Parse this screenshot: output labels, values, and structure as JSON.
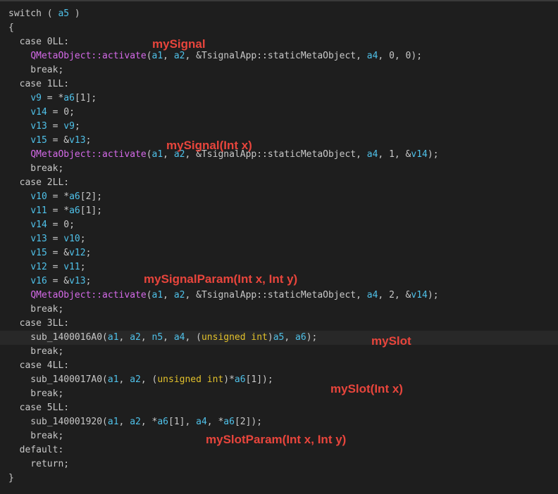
{
  "code": {
    "highlighted_line": 23,
    "lines": [
      [
        [
          "p",
          "switch ( "
        ],
        [
          "v",
          "a5"
        ],
        [
          "p",
          " )"
        ]
      ],
      [
        [
          "p",
          "{"
        ]
      ],
      [
        [
          "p",
          "  case 0LL:"
        ]
      ],
      [
        [
          "p",
          "    "
        ],
        [
          "f",
          "QMetaObject::activate"
        ],
        [
          "p",
          "("
        ],
        [
          "v",
          "a1"
        ],
        [
          "p",
          ", "
        ],
        [
          "v",
          "a2"
        ],
        [
          "p",
          ", &TsignalApp::staticMetaObject, "
        ],
        [
          "v",
          "a4"
        ],
        [
          "p",
          ", 0, 0);"
        ]
      ],
      [
        [
          "p",
          "    break;"
        ]
      ],
      [
        [
          "p",
          "  case 1LL:"
        ]
      ],
      [
        [
          "p",
          "    "
        ],
        [
          "v",
          "v9"
        ],
        [
          "p",
          " = *"
        ],
        [
          "v",
          "a6"
        ],
        [
          "p",
          "[1];"
        ]
      ],
      [
        [
          "p",
          "    "
        ],
        [
          "v",
          "v14"
        ],
        [
          "p",
          " = 0;"
        ]
      ],
      [
        [
          "p",
          "    "
        ],
        [
          "v",
          "v13"
        ],
        [
          "p",
          " = "
        ],
        [
          "v",
          "v9"
        ],
        [
          "p",
          ";"
        ]
      ],
      [
        [
          "p",
          "    "
        ],
        [
          "v",
          "v15"
        ],
        [
          "p",
          " = &"
        ],
        [
          "v",
          "v13"
        ],
        [
          "p",
          ";"
        ]
      ],
      [
        [
          "p",
          "    "
        ],
        [
          "f",
          "QMetaObject::activate"
        ],
        [
          "p",
          "("
        ],
        [
          "v",
          "a1"
        ],
        [
          "p",
          ", "
        ],
        [
          "v",
          "a2"
        ],
        [
          "p",
          ", &TsignalApp::staticMetaObject, "
        ],
        [
          "v",
          "a4"
        ],
        [
          "p",
          ", 1, &"
        ],
        [
          "v",
          "v14"
        ],
        [
          "p",
          ");"
        ]
      ],
      [
        [
          "p",
          "    break;"
        ]
      ],
      [
        [
          "p",
          "  case 2LL:"
        ]
      ],
      [
        [
          "p",
          "    "
        ],
        [
          "v",
          "v10"
        ],
        [
          "p",
          " = *"
        ],
        [
          "v",
          "a6"
        ],
        [
          "p",
          "[2];"
        ]
      ],
      [
        [
          "p",
          "    "
        ],
        [
          "v",
          "v11"
        ],
        [
          "p",
          " = *"
        ],
        [
          "v",
          "a6"
        ],
        [
          "p",
          "[1];"
        ]
      ],
      [
        [
          "p",
          "    "
        ],
        [
          "v",
          "v14"
        ],
        [
          "p",
          " = 0;"
        ]
      ],
      [
        [
          "p",
          "    "
        ],
        [
          "v",
          "v13"
        ],
        [
          "p",
          " = "
        ],
        [
          "v",
          "v10"
        ],
        [
          "p",
          ";"
        ]
      ],
      [
        [
          "p",
          "    "
        ],
        [
          "v",
          "v15"
        ],
        [
          "p",
          " = &"
        ],
        [
          "v",
          "v12"
        ],
        [
          "p",
          ";"
        ]
      ],
      [
        [
          "p",
          "    "
        ],
        [
          "v",
          "v12"
        ],
        [
          "p",
          " = "
        ],
        [
          "v",
          "v11"
        ],
        [
          "p",
          ";"
        ]
      ],
      [
        [
          "p",
          "    "
        ],
        [
          "v",
          "v16"
        ],
        [
          "p",
          " = &"
        ],
        [
          "v",
          "v13"
        ],
        [
          "p",
          ";"
        ]
      ],
      [
        [
          "p",
          "    "
        ],
        [
          "f",
          "QMetaObject::activate"
        ],
        [
          "p",
          "("
        ],
        [
          "v",
          "a1"
        ],
        [
          "p",
          ", "
        ],
        [
          "v",
          "a2"
        ],
        [
          "p",
          ", &TsignalApp::staticMetaObject, "
        ],
        [
          "v",
          "a4"
        ],
        [
          "p",
          ", 2, &"
        ],
        [
          "v",
          "v14"
        ],
        [
          "p",
          ");"
        ]
      ],
      [
        [
          "p",
          "    break;"
        ]
      ],
      [
        [
          "p",
          "  case 3LL:"
        ]
      ],
      [
        [
          "p",
          "    sub_1400016A0("
        ],
        [
          "v",
          "a1"
        ],
        [
          "p",
          ", "
        ],
        [
          "v",
          "a2"
        ],
        [
          "p",
          ", "
        ],
        [
          "v",
          "n5"
        ],
        [
          "p",
          ", "
        ],
        [
          "v",
          "a4"
        ],
        [
          "p",
          ", ("
        ],
        [
          "k",
          "unsigned int"
        ],
        [
          "p",
          ")"
        ],
        [
          "v",
          "a5"
        ],
        [
          "p",
          ", "
        ],
        [
          "v",
          "a6"
        ],
        [
          "p",
          ");"
        ]
      ],
      [
        [
          "p",
          "    break;"
        ]
      ],
      [
        [
          "p",
          "  case 4LL:"
        ]
      ],
      [
        [
          "p",
          "    sub_1400017A0("
        ],
        [
          "v",
          "a1"
        ],
        [
          "p",
          ", "
        ],
        [
          "v",
          "a2"
        ],
        [
          "p",
          ", ("
        ],
        [
          "k",
          "unsigned int"
        ],
        [
          "p",
          ")*"
        ],
        [
          "v",
          "a6"
        ],
        [
          "p",
          "[1]);"
        ]
      ],
      [
        [
          "p",
          "    break;"
        ]
      ],
      [
        [
          "p",
          "  case 5LL:"
        ]
      ],
      [
        [
          "p",
          "    sub_140001920("
        ],
        [
          "v",
          "a1"
        ],
        [
          "p",
          ", "
        ],
        [
          "v",
          "a2"
        ],
        [
          "p",
          ", *"
        ],
        [
          "v",
          "a6"
        ],
        [
          "p",
          "[1], "
        ],
        [
          "v",
          "a4"
        ],
        [
          "p",
          ", *"
        ],
        [
          "v",
          "a6"
        ],
        [
          "p",
          "[2]);"
        ]
      ],
      [
        [
          "p",
          "    break;"
        ]
      ],
      [
        [
          "p",
          "  default:"
        ]
      ],
      [
        [
          "p",
          "    return;"
        ]
      ],
      [
        [
          "p",
          "}"
        ]
      ]
    ]
  },
  "annotations": [
    {
      "text": "mySignal"
    },
    {
      "text": "mySignal(Int x)"
    },
    {
      "text": "mySignalParam(Int x, Int y)"
    },
    {
      "text": "mySlot"
    },
    {
      "text": "mySlot(Int x)"
    },
    {
      "text": "mySlotParam(Int x, Int y)"
    }
  ]
}
